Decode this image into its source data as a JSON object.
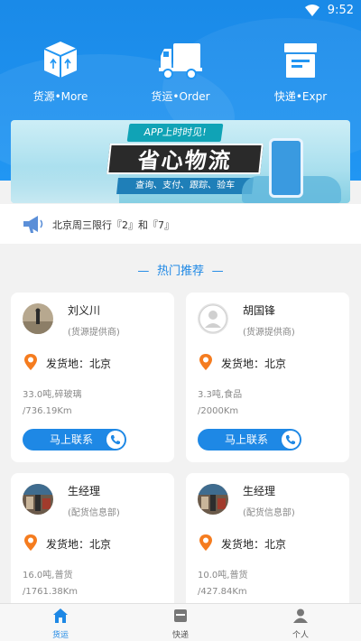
{
  "status_bar": {
    "time": "9:52"
  },
  "quick_actions": [
    {
      "label": "货源•More",
      "icon": "cargo-box-icon"
    },
    {
      "label": "货运•Order",
      "icon": "truck-icon"
    },
    {
      "label": "快递•Expr",
      "icon": "express-package-icon"
    }
  ],
  "banner": {
    "ribbon": "APP上时时见!",
    "title": "省心物流",
    "subtitle": "查询、支付、跟踪、验车"
  },
  "notice": {
    "text": "北京周三限行『2』和『7』"
  },
  "section": {
    "title": "热门推荐"
  },
  "cards": [
    {
      "name": "刘义川",
      "role": "(货源提供商)",
      "origin": "发货地：北京",
      "goods": "33.0吨,碎玻璃",
      "distance": "/736.19Km",
      "contact": "马上联系"
    },
    {
      "name": "胡国锋",
      "role": "(货源提供商)",
      "origin": "发货地：北京",
      "goods": "3.3吨,食品",
      "distance": "/2000Km",
      "contact": "马上联系"
    },
    {
      "name": "生经理",
      "role": "(配货信息部)",
      "origin": "发货地：北京",
      "goods": "16.0吨,普货",
      "distance": "/1761.38Km"
    },
    {
      "name": "生经理",
      "role": "(配货信息部)",
      "origin": "发货地：北京",
      "goods": "10.0吨,普货",
      "distance": "/427.84Km"
    }
  ],
  "tabs": [
    {
      "label": "货运",
      "icon": "home-icon",
      "active": true
    },
    {
      "label": "快递",
      "icon": "box-icon",
      "active": false
    },
    {
      "label": "个人",
      "icon": "person-icon",
      "active": false
    }
  ],
  "colors": {
    "primary": "#1e88e5",
    "header": "#2196f3",
    "pin": "#f57c1f"
  }
}
